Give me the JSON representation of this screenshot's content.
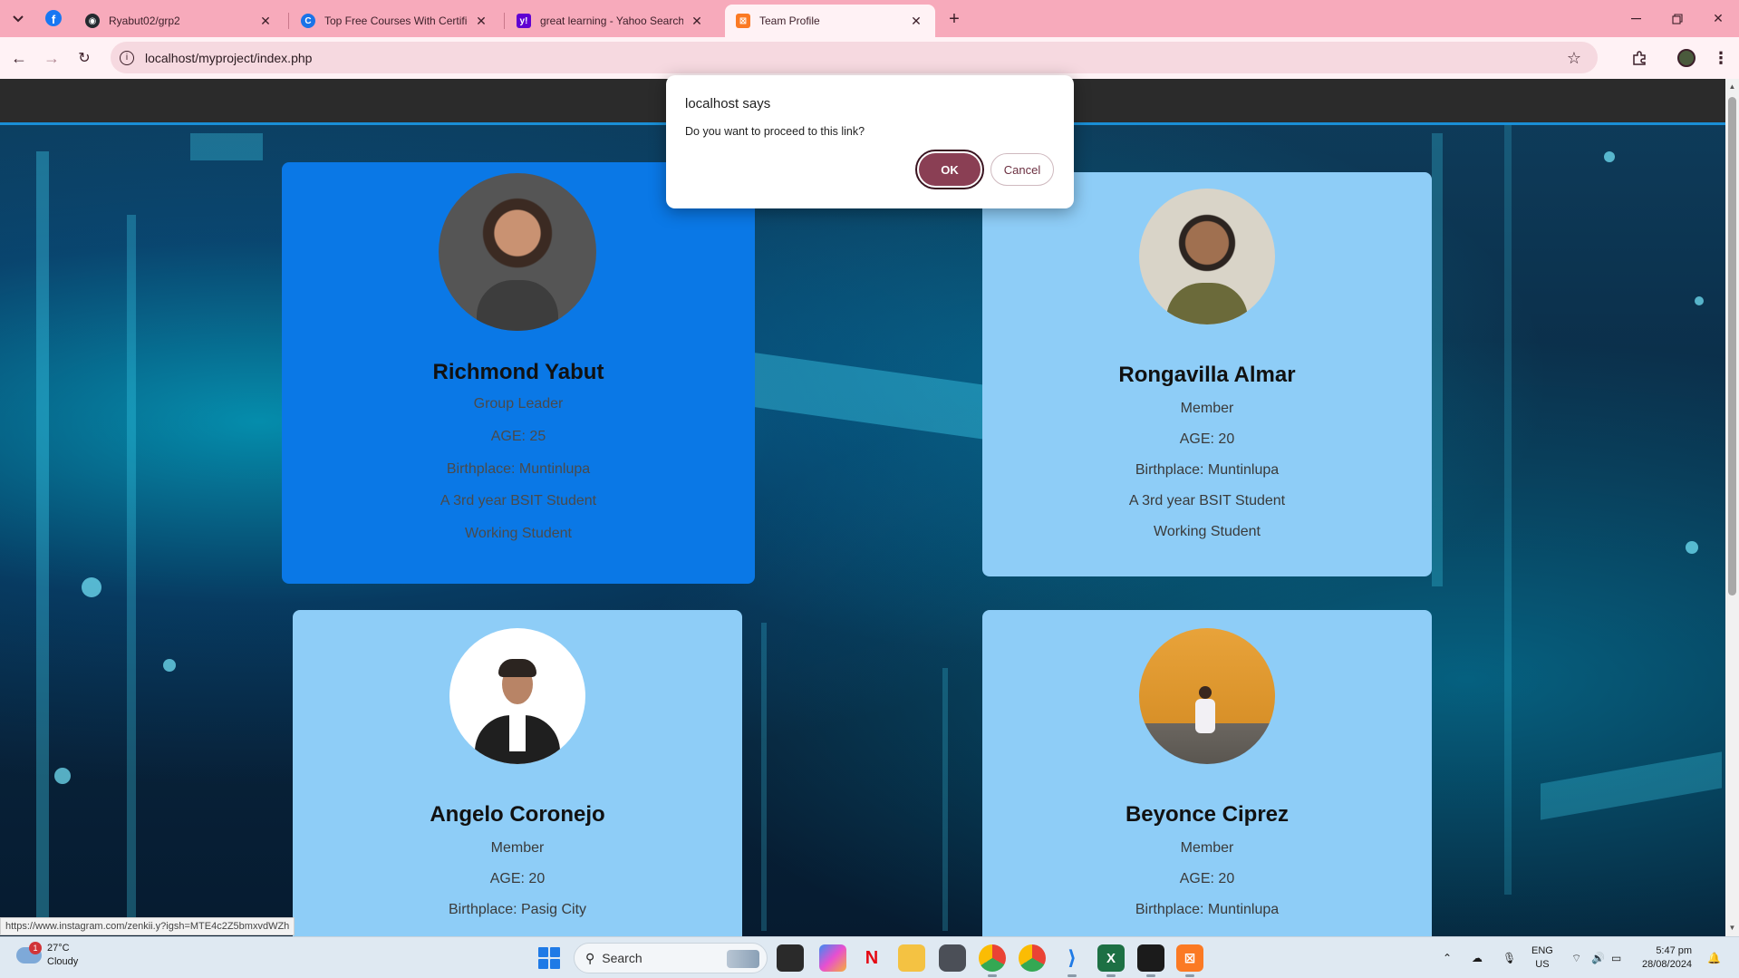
{
  "browser": {
    "tabs": [
      {
        "label": "Ryabut02/grp2",
        "icon": "github-icon"
      },
      {
        "label": "Top Free Courses With Certifica",
        "icon": "greatlearning-icon"
      },
      {
        "label": "great learning - Yahoo Search R",
        "icon": "yahoo-icon"
      },
      {
        "label": "Team Profile",
        "icon": "xampp-icon",
        "active": true
      }
    ],
    "url": "localhost/myproject/index.php"
  },
  "dialog": {
    "title": "localhost says",
    "message": "Do you want to proceed to this link?",
    "ok_label": "OK",
    "cancel_label": "Cancel"
  },
  "team": [
    {
      "name": "Richmond Yabut",
      "role": "Group Leader",
      "age": "AGE: 25",
      "birthplace": "Birthplace: Muntinlupa",
      "year": "A 3rd year BSIT Student",
      "status": "Working Student"
    },
    {
      "name": "Rongavilla Almar",
      "role": "Member",
      "age": "AGE: 20",
      "birthplace": "Birthplace: Muntinlupa",
      "year": "A 3rd year BSIT Student",
      "status": "Working Student"
    },
    {
      "name": "Angelo Coronejo",
      "role": "Member",
      "age": "AGE: 20",
      "birthplace": "Birthplace: Pasig City"
    },
    {
      "name": "Beyonce Ciprez",
      "role": "Member",
      "age": "AGE: 20",
      "birthplace": "Birthplace: Muntinlupa"
    }
  ],
  "status_bar_url": "https://www.instagram.com/zenkii.y?igsh=MTE4c2Z5bmxvdWZh",
  "taskbar": {
    "weather_temp": "27°C",
    "weather_desc": "Cloudy",
    "weather_badge": "1",
    "search_label": "Search",
    "lang_1": "ENG",
    "lang_2": "US",
    "time": "5:47 pm",
    "date": "28/08/2024"
  },
  "colors": {
    "tab_strip": "#f7aabb",
    "toolbar": "#fff2f5",
    "card": "#8ecdf7",
    "card_highlight": "#0a78e6",
    "ok_button": "#8a3f54"
  }
}
